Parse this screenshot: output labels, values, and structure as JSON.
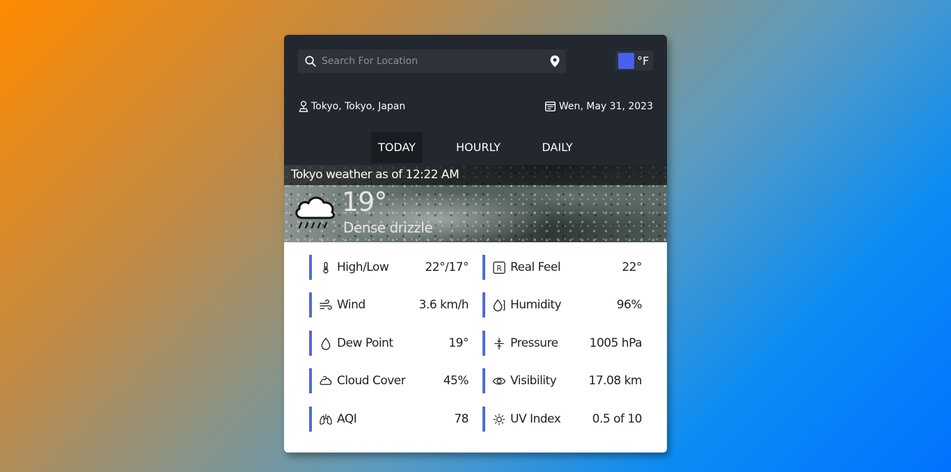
{
  "search": {
    "placeholder": "Search For Location"
  },
  "unit_toggle": {
    "label": "°F",
    "accent": "#4660f0"
  },
  "location": {
    "text": "Tokyo, Tokyo, Japan",
    "icon": "person-pin-icon"
  },
  "date": {
    "text": "Wen, May 31, 2023",
    "icon": "calendar-icon"
  },
  "tabs": [
    {
      "label": "TODAY",
      "active": true
    },
    {
      "label": "HOURLY",
      "active": false
    },
    {
      "label": "DAILY",
      "active": false
    }
  ],
  "current": {
    "title": "Tokyo weather as of 12:22 AM",
    "temperature": "19°",
    "condition": "Dense drizzle",
    "icon": "cloud-rain-icon"
  },
  "stats": [
    {
      "label": "High/Low",
      "value": "22°/17°",
      "icon": "thermometer-icon"
    },
    {
      "label": "Real Feel",
      "value": "22°",
      "icon": "real-feel-icon"
    },
    {
      "label": "Wind",
      "value": "3.6 km/h",
      "icon": "wind-icon"
    },
    {
      "label": "Humidity",
      "value": "96%",
      "icon": "humidity-icon"
    },
    {
      "label": "Dew Point",
      "value": "19°",
      "icon": "droplet-icon"
    },
    {
      "label": "Pressure",
      "value": "1005 hPa",
      "icon": "pressure-icon"
    },
    {
      "label": "Cloud Cover",
      "value": "45%",
      "icon": "cloud-cover-icon"
    },
    {
      "label": "Visibility",
      "value": "17.08 km",
      "icon": "eye-icon"
    },
    {
      "label": "AQI",
      "value": "78",
      "icon": "lungs-icon"
    },
    {
      "label": "UV Index",
      "value": "0.5 of 10",
      "icon": "sun-icon"
    }
  ],
  "colors": {
    "accent_bar": "#4f6ad6",
    "panel_dark": "#23272f"
  }
}
